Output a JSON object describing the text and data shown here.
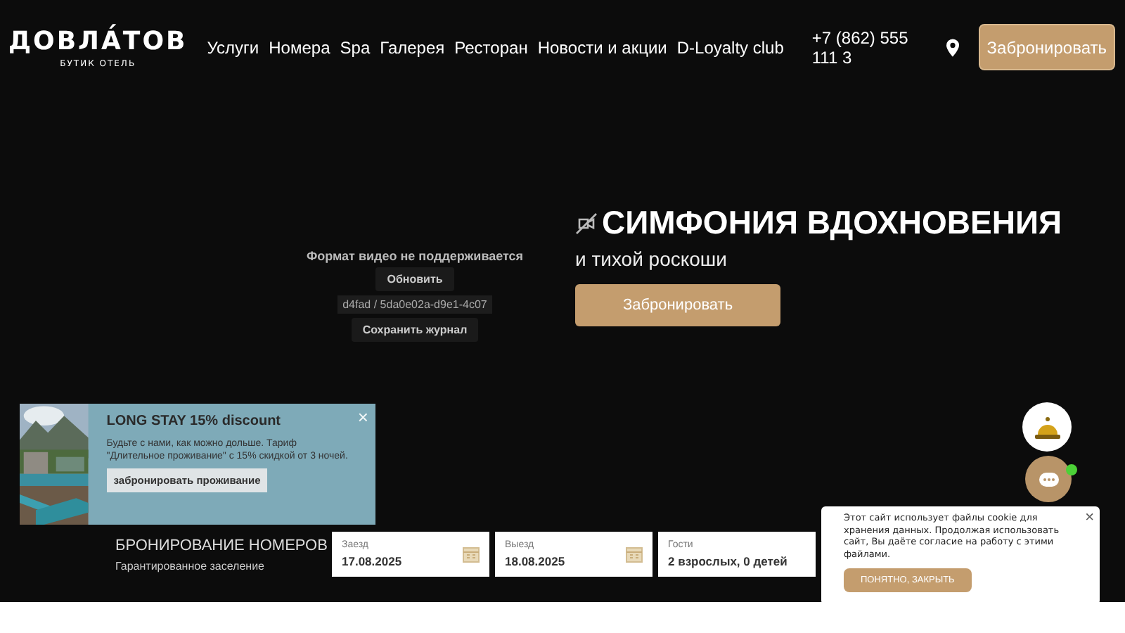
{
  "header": {
    "logo": "ДОВЛА́ТОВ",
    "logo_subtitle": "БУТИК ОТЕЛЬ",
    "nav": [
      "Услуги",
      "Номера",
      "Spa",
      "Галерея",
      "Ресторан",
      "Новости и акции",
      "D-Loyalty club"
    ],
    "phone": "+7 (862) 555 111 3",
    "book_button": "Забронировать"
  },
  "video_error": {
    "message": "Формат видео не поддерживается",
    "refresh_button": "Обновить",
    "log_id": "d4fad / 5da0e02a-d9e1-4c07",
    "save_log_button": "Сохранить журнал"
  },
  "hero": {
    "title": "СИМФОНИЯ ВДОХНОВЕНИЯ",
    "subtitle": "и тихой роскоши",
    "book_button": "Забронировать"
  },
  "booking": {
    "title": "БРОНИРОВАНИЕ НОМЕРОВ",
    "subtitle": "Гарантированное заселение",
    "fields": [
      {
        "label": "Заезд",
        "value": "17.08.2025",
        "kind": "date"
      },
      {
        "label": "Выезд",
        "value": "18.08.2025",
        "kind": "date"
      },
      {
        "label": "Гости",
        "value": "2 взрослых, 0 детей",
        "kind": "text"
      }
    ]
  },
  "promo": {
    "title": "LONG STAY 15% discount",
    "text": "Будьте с нами, как можно дольше. Тариф \"Длительное проживание\" с 15% скидкой от 3 ночей.",
    "button": "забронировать проживание",
    "close": "×"
  },
  "chat": {
    "online": true
  },
  "cookie": {
    "text": "Этот сайт использует файлы cookie для хранения данных. Продолжая использовать сайт, Вы даёте согласие на работу с этими файлами.",
    "button": "ПОНЯТНО, ЗАКРЫТЬ",
    "close": "×"
  }
}
